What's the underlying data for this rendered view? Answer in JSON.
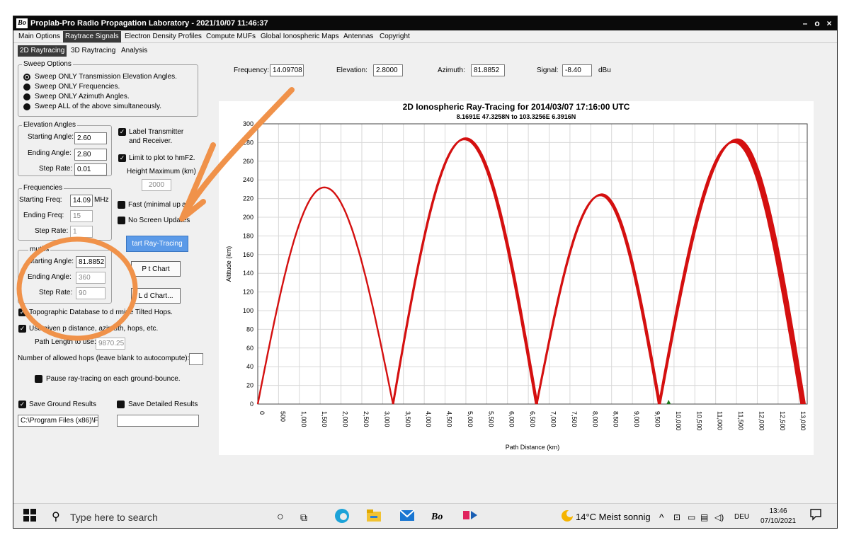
{
  "window": {
    "title": "Proplab-Pro Radio Propagation Laboratory - 2021/10/07 11:46:37",
    "app_icon_text": "Bo",
    "minimize": "–",
    "restore": "o",
    "close": "×"
  },
  "menu": {
    "tabs": [
      {
        "label": "Main Options",
        "active": false
      },
      {
        "label": "Raytrace Signals",
        "active": true
      },
      {
        "label": "Electron Density Profiles",
        "active": false
      },
      {
        "label": "Compute MUFs",
        "active": false
      },
      {
        "label": "Global Ionospheric Maps",
        "active": false
      },
      {
        "label": "Antennas",
        "active": false
      },
      {
        "label": "Copyright",
        "active": false
      }
    ]
  },
  "subtabs": [
    {
      "label": "2D Raytracing",
      "active": true
    },
    {
      "label": "3D Raytracing",
      "active": false
    },
    {
      "label": "Analysis",
      "active": false
    }
  ],
  "sweep": {
    "legend": "Sweep Options",
    "options": [
      {
        "label": "Sweep ONLY Transmission Elevation Angles.",
        "selected": true
      },
      {
        "label": "Sweep ONLY Frequencies.",
        "selected": false
      },
      {
        "label": "Sweep ONLY Azimuth Angles.",
        "selected": false
      },
      {
        "label": "Sweep ALL of the above simultaneously.",
        "selected": false
      }
    ]
  },
  "elevation": {
    "legend": "Elevation Angles",
    "starting_label": "Starting Angle:",
    "starting_value": "2.60",
    "ending_label": "Ending Angle:",
    "ending_value": "2.80",
    "step_label": "Step Rate:",
    "step_value": "0.01"
  },
  "options": {
    "label_tx": "Label Transmitter",
    "label_tx2": "and Receiver.",
    "limit_hmf2": "Limit to plot to hmF2.",
    "height_max_label": "Height Maximum (km)",
    "height_max_value": "2000",
    "fast": "Fast (minimal up",
    "fast_tail": "ate",
    "no_screen": "No Screen Updates"
  },
  "frequencies": {
    "legend": "Frequencies",
    "starting_label": "Starting Freq:",
    "starting_value": "14.09",
    "unit": "MHz",
    "ending_label": "Ending Freq:",
    "ending_value": "15",
    "step_label": "Step Rate:",
    "step_value": "1"
  },
  "azimuths": {
    "legend": "muths",
    "starting_label": "Starting Angle:",
    "starting_value": "81.8852",
    "ending_label": "Ending Angle:",
    "ending_value": "360",
    "step_label": "Step Rate:",
    "step_value": "90"
  },
  "buttons": {
    "start": "tart Ray-Tracing",
    "print": "P     t Chart",
    "load": "L   d Chart..."
  },
  "misc": {
    "topo": "Topographic Database to d    rmine Tilted  Hops.",
    "use_given": "Use given p                        distance, azimuth, hops, etc.",
    "path_length_label": "Path Length to use:",
    "path_length_value": "9870.25",
    "allowed_hops": "Number of allowed hops (leave blank to autocompute):",
    "allowed_hops_value": "",
    "pause": "Pause ray-tracing on each ground-bounce.",
    "save_ground": "Save Ground Results",
    "save_detailed": "Save Detailed Results",
    "ground_path": "C:\\Program Files (x86)\\F",
    "detailed_path": ""
  },
  "readouts": {
    "frequency_label": "Frequency:",
    "frequency_value": "14.09708",
    "elevation_label": "Elevation:",
    "elevation_value": "2.8000",
    "azimuth_label": "Azimuth:",
    "azimuth_value": "81.8852",
    "signal_label": "Signal:",
    "signal_value": "-8.40",
    "signal_unit": "dBu"
  },
  "chart_data": {
    "type": "line",
    "title": "2D Ionospheric Ray-Tracing  for  2014/03/07  17:16:00  UTC",
    "subtitle": "8.1691E 47.3258N to 103.3256E  6.3916N",
    "xlabel": "Path Distance (km)",
    "ylabel": "Altitude (km)",
    "xlim": [
      0,
      13200
    ],
    "ylim": [
      0,
      300
    ],
    "grid": true,
    "x_ticks": [
      "0",
      "500",
      "1,000",
      "1,500",
      "2,000",
      "2,500",
      "3,000",
      "3,500",
      "4,000",
      "4,500",
      "5,000",
      "5,500",
      "6,000",
      "6,500",
      "7,000",
      "7,500",
      "8,000",
      "8,500",
      "9,000",
      "9,500",
      "10,000",
      "10,500",
      "11,000",
      "11,500",
      "12,000",
      "12,500",
      "13,000"
    ],
    "y_ticks": [
      "0",
      "20",
      "40",
      "60",
      "80",
      "100",
      "120",
      "140",
      "160",
      "180",
      "200",
      "220",
      "240",
      "260",
      "280",
      "300"
    ],
    "line_color": "#d41010",
    "receiver_marker_x": 9870,
    "hops": [
      {
        "start": 0,
        "peak_x": 1600,
        "peak_y": 232,
        "end": 3250
      },
      {
        "start": 3250,
        "peak_x": 4980,
        "peak_y": 284,
        "end": 6700
      },
      {
        "start": 6700,
        "peak_x": 8250,
        "peak_y": 224,
        "end": 9650
      },
      {
        "start": 9650,
        "peak_x": 11480,
        "peak_y": 282,
        "end": 13100
      }
    ]
  },
  "taskbar": {
    "search_placeholder": "Type here to search",
    "weather": "14°C  Meist sonnig",
    "lang": "DEU",
    "time": "13:46",
    "date": "07/10/2021"
  }
}
